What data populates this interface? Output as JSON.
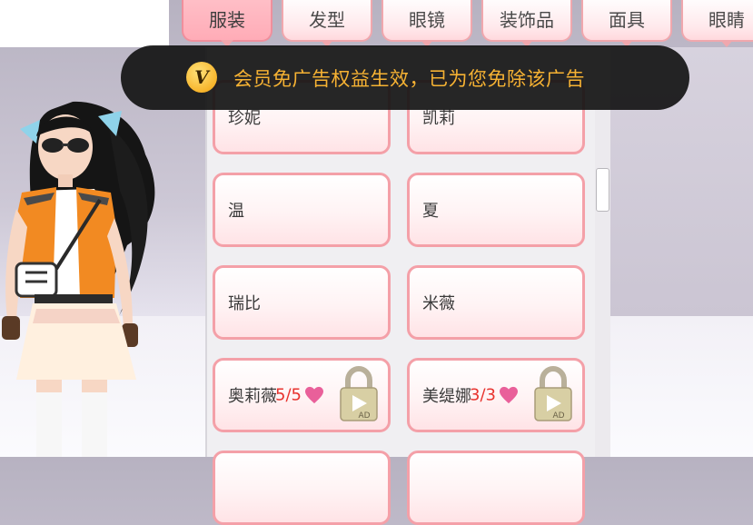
{
  "tabs": [
    {
      "label": "服装",
      "active": true
    },
    {
      "label": "发型",
      "active": false
    },
    {
      "label": "眼镜",
      "active": false
    },
    {
      "label": "装饰品",
      "active": false
    },
    {
      "label": "面具",
      "active": false
    },
    {
      "label": "眼睛",
      "active": false
    }
  ],
  "toast": {
    "badge": "V",
    "text": "会员免广告权益生效，已为您免除该广告"
  },
  "items": [
    {
      "name": "珍妮"
    },
    {
      "name": "凯莉"
    },
    {
      "name": "温"
    },
    {
      "name": "夏"
    },
    {
      "name": "瑞比"
    },
    {
      "name": "米薇"
    },
    {
      "name": "奥莉薇",
      "count": "5/5",
      "locked": true,
      "ad_label": "AD"
    },
    {
      "name": "美缇娜",
      "count": "3/3",
      "locked": true,
      "ad_label": "AD"
    }
  ],
  "colors": {
    "accent_pink": "#f4a0a8",
    "count_red": "#e8332e",
    "toast_text": "#f6b233",
    "heart": "#e9609a"
  },
  "icons": {
    "vip": "vip-badge-icon",
    "heart": "heart-icon",
    "lock_ad": "lock-ad-icon"
  }
}
